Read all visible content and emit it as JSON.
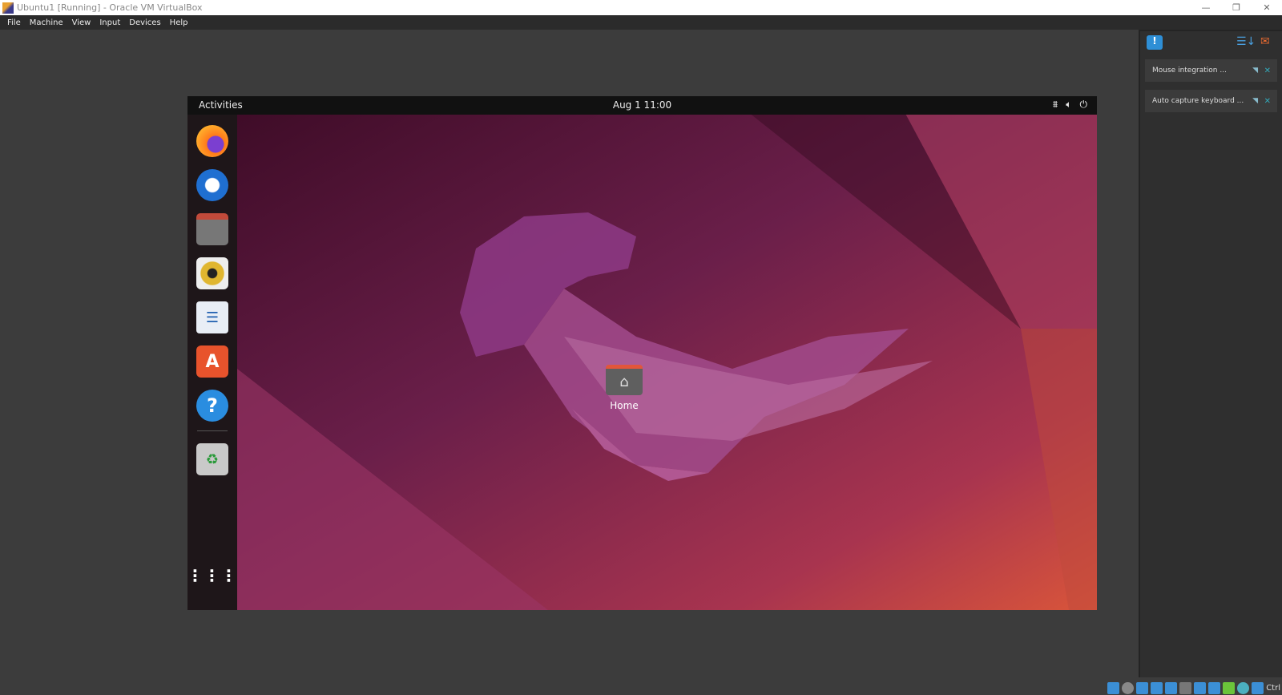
{
  "window": {
    "title": "Ubuntu1 [Running] - Oracle VM VirtualBox",
    "controls": [
      "—",
      "❐",
      "✕"
    ]
  },
  "menu": [
    "File",
    "Machine",
    "View",
    "Input",
    "Devices",
    "Help"
  ],
  "guest": {
    "topbar": {
      "activities": "Activities",
      "clock": "Aug 1  11:00",
      "tray": [
        "network-icon",
        "volume-icon",
        "power-icon"
      ]
    },
    "dock": [
      "Firefox",
      "Thunderbird",
      "Files",
      "Rhythmbox",
      "LibreOffice Writer",
      "Ubuntu Software",
      "Help",
      "Trash",
      "Show Applications"
    ],
    "desktop_icons": [
      {
        "label": "Home"
      }
    ]
  },
  "notifications": [
    {
      "text": "Mouse integration ..."
    },
    {
      "text": "Auto capture keyboard ..."
    }
  ],
  "statusbar": {
    "host_key": "Ctrl"
  },
  "colors": {
    "wall_dark": "#3a0a24",
    "wall_mid": "#7a2454",
    "wall_orange": "#d9553a"
  }
}
